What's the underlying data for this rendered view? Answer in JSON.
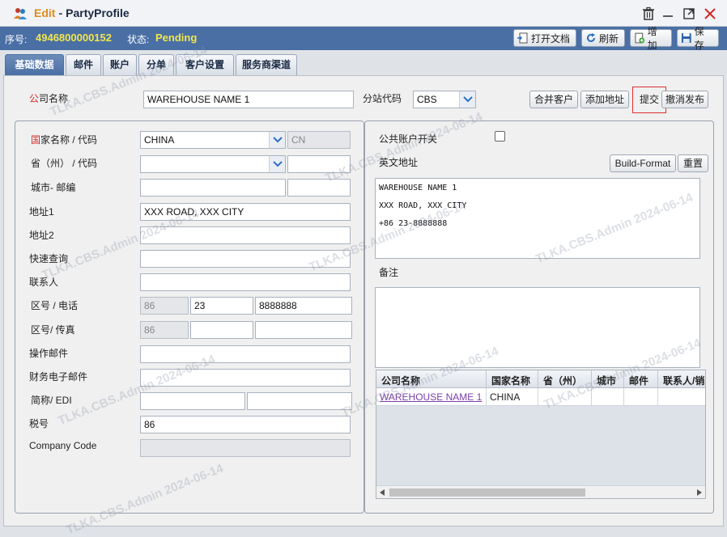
{
  "window": {
    "mode": "Edit",
    "separator": "-",
    "title": "PartyProfile"
  },
  "status": {
    "seq_label": "序号:",
    "seq_value": "4946800000152",
    "state_label": "状态:",
    "state_value": "Pending"
  },
  "toolbar": {
    "open_doc": "打开文档",
    "refresh": "刷新",
    "add": "增加",
    "save": "保存"
  },
  "tabs": [
    "基础数据",
    "邮件",
    "账户",
    "分单",
    "客户设置",
    "服务商渠道"
  ],
  "top": {
    "company_label_red": "公",
    "company_label_rest": "司名称",
    "company_value": "WAREHOUSE NAME 1",
    "branch_label": "分站代码",
    "branch_value": "CBS",
    "merge_btn": "合并客户",
    "add_address_btn": "添加地址",
    "submit_btn": "提交",
    "cancel_publish_btn": "撤消发布"
  },
  "left": {
    "country_label_red": "国",
    "country_label_rest": "家名称 / 代码",
    "country_value": "CHINA",
    "country_code": "CN",
    "province_label": "省（州） / 代码",
    "city_label": "城市- 邮编",
    "addr1_label": "地址1",
    "addr1_value": "XXX ROAD, XXX CITY",
    "addr2_label": "地址2",
    "quick_label": "快速查询",
    "contact_label": "联系人",
    "phone_label": "区号 / 电话",
    "phone_cc": "86",
    "phone_area": "23",
    "phone_number": "8888888",
    "fax_label": "区号/ 传真",
    "fax_cc": "86",
    "op_mail_label": "操作邮件",
    "fin_mail_label": "财务电子邮件",
    "edi_label": "简称/ EDI",
    "tax_label": "税号",
    "tax_value": "86",
    "company_code_label": "Company Code"
  },
  "right": {
    "public_account_label": "公共账户开关",
    "en_address_label": "英文地址",
    "build_format_btn": "Build-Format",
    "reset_btn": "重置",
    "address_lines": [
      "WAREHOUSE NAME 1",
      "XXX ROAD, XXX CITY",
      "+86 23-8888888"
    ],
    "remark_label": "备注",
    "grid": {
      "headers": [
        "公司名称",
        "国家名称",
        "省（州）",
        "城市",
        "邮件",
        "联系人/销"
      ],
      "row": [
        "WAREHOUSE NAME 1",
        "CHINA",
        "",
        "",
        "",
        ""
      ]
    }
  },
  "watermark": "TLKA.CBS.Admin 2024-06-14",
  "colors": {
    "status_bar": "#4a6fa5",
    "status_value": "#f2e64a",
    "edit_title": "#e08a1e",
    "required_mark": "#d42a2a",
    "link": "#7a3fa8",
    "highlight_border": "#e03030"
  }
}
